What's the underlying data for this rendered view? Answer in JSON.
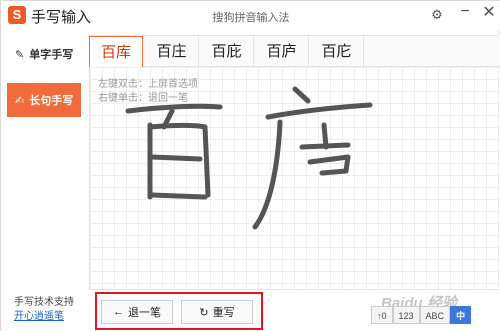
{
  "titlebar": {
    "app_name": "手写输入",
    "window_title": "搜狗拼音输入法",
    "logo_glyph": "S",
    "settings_icon": "gear-icon",
    "close_icon": "close-icon"
  },
  "sidebar": {
    "single_char_label": "单字手写",
    "long_sentence_label": "长句手写",
    "support_text": "手写技术支持",
    "support_link": "开心逍遥笔"
  },
  "candidates": [
    "百库",
    "百庄",
    "百庇",
    "百庐",
    "百庀"
  ],
  "pad": {
    "hint_line1": "左键双击：上屏首选项",
    "hint_line2": "右键单击：退回一笔"
  },
  "buttons": {
    "undo_label": "退一笔",
    "undo_icon": "←",
    "rewrite_label": "重写",
    "rewrite_icon": "↻"
  },
  "modes": [
    "↑0",
    "123",
    "ABC",
    "中"
  ],
  "watermark": "Baidu 经验",
  "colors": {
    "accent": "#f26b3a",
    "highlight_border": "#e0161b",
    "active_mode": "#3c78d8"
  }
}
